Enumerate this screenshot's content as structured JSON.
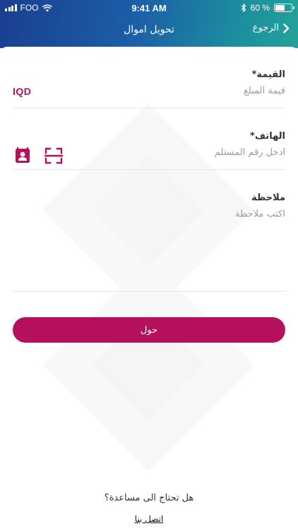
{
  "status_bar": {
    "carrier": "FOO",
    "time": "9:41 AM",
    "battery_text": "60 %",
    "battery_level": 0.6,
    "icons": [
      "signal-icon",
      "wifi-icon",
      "bluetooth-icon",
      "battery-icon"
    ]
  },
  "header": {
    "title": "تحويل اموال",
    "back_label": "الرجوع",
    "back_icon": "chevron-right-icon"
  },
  "form": {
    "amount": {
      "label": "القيمة*",
      "placeholder": "قيمة المبلغ",
      "value": "",
      "currency": "IQD"
    },
    "phone": {
      "label": "الهاتف*",
      "placeholder": "ادخل رقم المستلم",
      "value": "",
      "icons": [
        "contacts-icon",
        "scan-icon"
      ]
    },
    "note": {
      "label": "ملاحظة",
      "placeholder": "اكتب ملاحظة",
      "value": ""
    },
    "submit_label": "حول"
  },
  "footer": {
    "help_text": "هل تحتاج الى مساعدة؟",
    "contact_link": "اتصل بنا"
  },
  "colors": {
    "accent": "#b5105c",
    "header_start": "#1a3f8f",
    "header_end": "#23a29a"
  }
}
